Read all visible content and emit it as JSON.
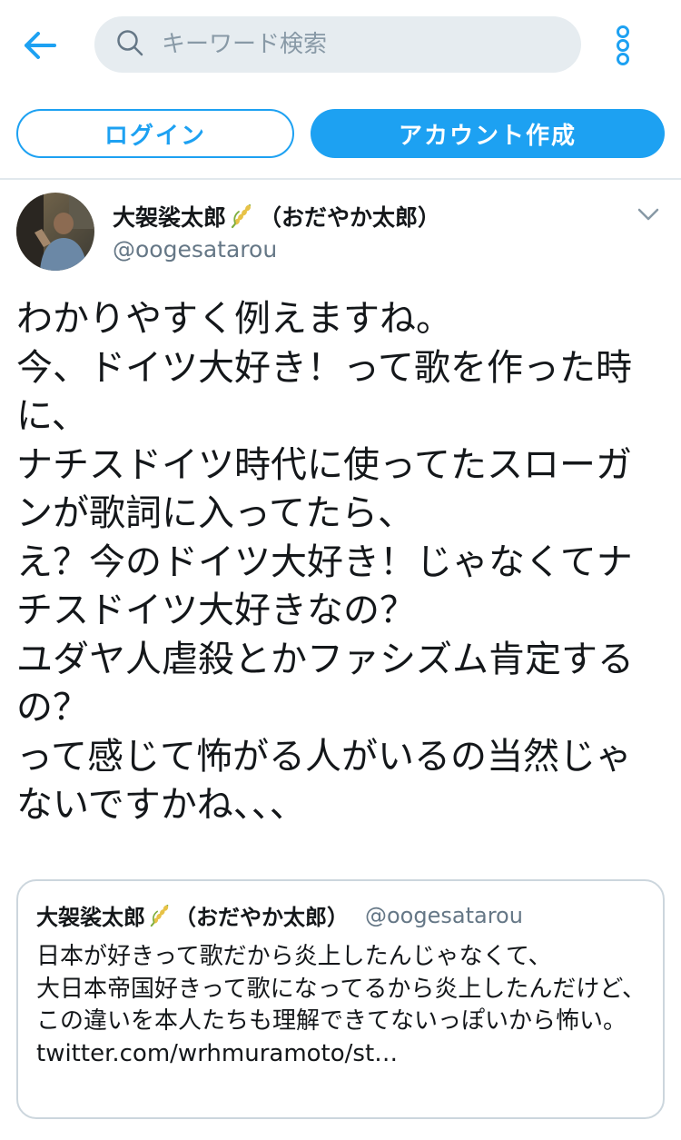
{
  "header": {
    "back_icon": "back-arrow-icon",
    "search_placeholder": "キーワード検索",
    "search_icon": "search-icon",
    "more_icon": "more-vertical-icon",
    "accent_color": "#1da1f2"
  },
  "auth": {
    "login_label": "ログイン",
    "signup_label": "アカウント作成"
  },
  "tweet": {
    "display_name": "大袈裟太郎",
    "name_suffix": "（おだやか太郎）",
    "name_emoji": "rice-plant-icon",
    "handle": "@oogesatarou",
    "text": "わかりやすく例えますね。\n今、ドイツ大好き！って歌を作った時に、\nナチスドイツ時代に使ってたスローガンが歌詞に入ってたら、\nえ？今のドイツ大好き！じゃなくてナチスドイツ大好きなの？\nユダヤ人虐殺とかファシズム肯定するの？\nって感じて怖がる人がいるの当然じゃないですかね、、、"
  },
  "quoted": {
    "display_name": "大袈裟太郎",
    "name_suffix": "（おだやか太郎）",
    "handle": "@oogesatarou",
    "text": "日本が好きって歌だから炎上したんじゃなくて、\n大日本帝国好きって歌になってるから炎上したんだけど、\nこの違いを本人たちも理解できてないっぽいから怖い。 twitter.com/wrhmuramoto/st…"
  }
}
